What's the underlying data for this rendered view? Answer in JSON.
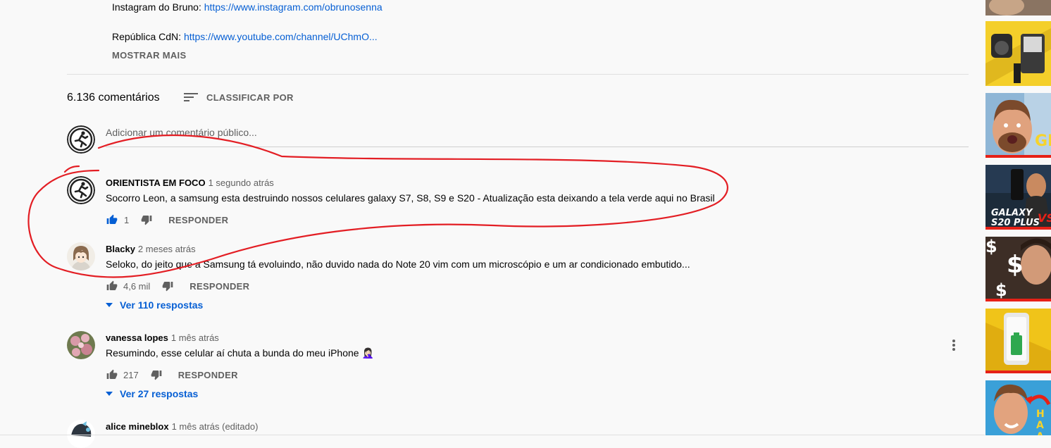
{
  "description": {
    "instagram_label": "Instagram do Bruno:",
    "instagram_link": "https://www.instagram.com/obrunosenna",
    "republica_label": "República CdN:",
    "republica_link": "https://www.youtube.com/channel/UChmO...",
    "show_more": "MOSTRAR MAIS"
  },
  "comments_header": {
    "count": "6.136 comentários",
    "sort_label": "CLASSIFICAR POR"
  },
  "add_comment": {
    "placeholder": "Adicionar um comentário público..."
  },
  "comments": [
    {
      "author": "ORIENTISTA EM FOCO",
      "time": "1 segundo atrás",
      "text": "Socorro Leon, a samsung esta destruindo nossos celulares galaxy S7, S8, S9 e S20 - Atualização esta deixando a tela verde aqui no Brasil",
      "likes": "1",
      "reply_label": "RESPONDER",
      "like_active": true
    },
    {
      "author": "Blacky",
      "time": "2 meses atrás",
      "text": "Seloko, do jeito que a Samsung tá evoluindo, não duvido nada do Note 20 vim com um microscópio e um ar condicionado embutido...",
      "likes": "4,6 mil",
      "reply_label": "RESPONDER",
      "replies": "Ver 110 respostas"
    },
    {
      "author": "vanessa lopes",
      "time": "1 mês atrás",
      "text": "Resumindo, esse celular aí chuta a bunda do meu iPhone 🤦🏻‍♀️",
      "likes": "217",
      "reply_label": "RESPONDER",
      "replies": "Ver 27 respostas"
    },
    {
      "author": "alice mineblox",
      "time": "1 mês atrás (editado)"
    }
  ],
  "sidebar_thumbnails": {
    "thumb3_text": "GE",
    "thumb4_line1": "GALAXY",
    "thumb4_line2": "S20 PLUS",
    "thumb4_vs": "VS",
    "thumb5_symbol": "$",
    "thumb7_text": "HA A"
  },
  "colors": {
    "link": "#065fd4",
    "annotation_red": "#e31e24",
    "like_active": "#065fd4"
  }
}
